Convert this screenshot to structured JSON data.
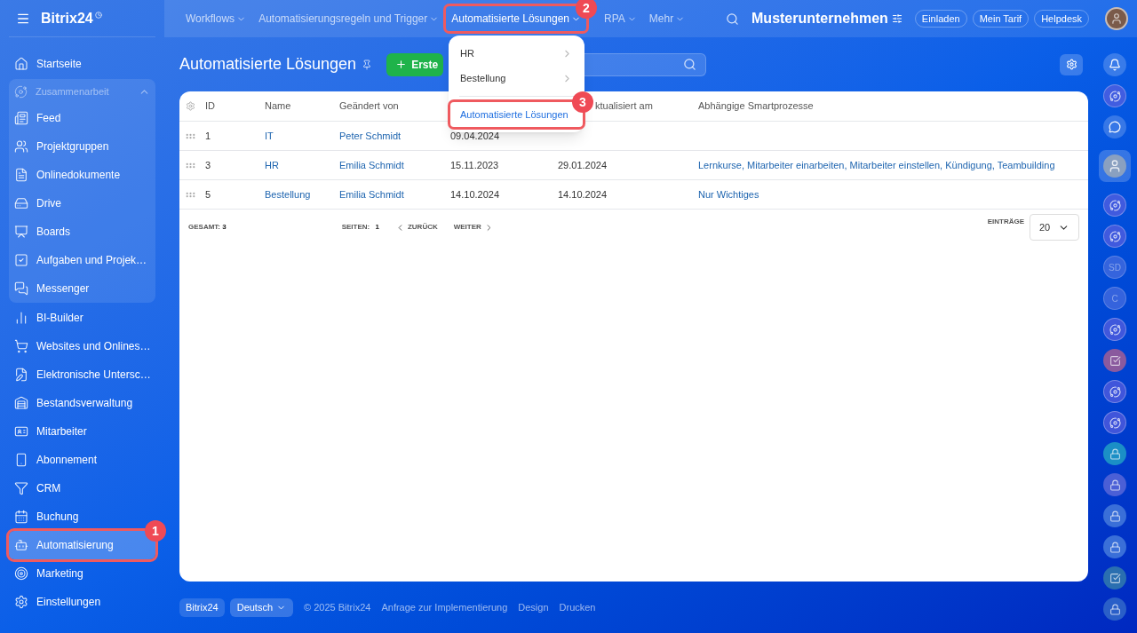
{
  "logo": {
    "text": "Bitrix24"
  },
  "sidebar": {
    "items": [
      {
        "kind": "link",
        "label": "Startseite",
        "selected": false
      },
      {
        "kind": "group",
        "label": "Zusammenarbeit",
        "expanded": true,
        "children": [
          {
            "kind": "link",
            "label": "Feed",
            "selected": false
          },
          {
            "kind": "link",
            "label": "Projektgruppen",
            "selected": false
          },
          {
            "kind": "link",
            "label": "Onlinedokumente",
            "selected": false
          },
          {
            "kind": "link",
            "label": "Drive",
            "selected": false
          },
          {
            "kind": "link",
            "label": "Boards",
            "selected": false
          },
          {
            "kind": "link",
            "label": "Aufgaben und Projek…",
            "selected": false
          },
          {
            "kind": "link",
            "label": "Messenger",
            "selected": false
          }
        ]
      },
      {
        "kind": "link",
        "label": "BI-Builder",
        "selected": false
      },
      {
        "kind": "link",
        "label": "Websites und Onlines…",
        "selected": false
      },
      {
        "kind": "link",
        "label": "Elektronische Untersc…",
        "selected": false
      },
      {
        "kind": "link",
        "label": "Bestandsverwaltung",
        "selected": false
      },
      {
        "kind": "link",
        "label": "Mitarbeiter",
        "selected": false
      },
      {
        "kind": "link",
        "label": "Abonnement",
        "selected": false
      },
      {
        "kind": "link",
        "label": "CRM",
        "selected": false
      },
      {
        "kind": "link",
        "label": "Buchung",
        "selected": false
      },
      {
        "kind": "link",
        "label": "Automatisierung",
        "selected": true,
        "annotation": "1"
      },
      {
        "kind": "link",
        "label": "Marketing",
        "selected": false
      },
      {
        "kind": "link",
        "label": "Einstellungen",
        "selected": false
      }
    ]
  },
  "top_nav": {
    "items": [
      {
        "label": "Workflows",
        "selected": false
      },
      {
        "label": "Automatisierungsregeln und Trigger",
        "selected": false
      },
      {
        "label": "Automatisierte Lösungen",
        "selected": true,
        "annotation": "2"
      },
      {
        "label": "RPA",
        "selected": false
      },
      {
        "label": "Mehr",
        "selected": false
      }
    ],
    "company": "Musterunternehmen",
    "buttons": [
      "Einladen",
      "Mein Tarif",
      "Helpdesk"
    ]
  },
  "dropdown": {
    "items": [
      {
        "kind": "submenu",
        "label": "HR",
        "selected": false
      },
      {
        "kind": "submenu",
        "label": "Bestellung",
        "selected": false
      },
      {
        "kind": "link",
        "label": "Automatisierte Lösungen",
        "selected": true,
        "annotation": "3"
      }
    ]
  },
  "page": {
    "title": "Automatisierte Lösungen",
    "create_button": "Erste"
  },
  "table": {
    "columns": [
      "ID",
      "Name",
      "Geändert von",
      "ktualisiert am",
      "Abhängige Smartprozesse"
    ],
    "rows": [
      {
        "id": "1",
        "name": "IT",
        "changed_by": "Peter Schmidt",
        "created": "09.04.2024"
      },
      {
        "id": "3",
        "name": "HR",
        "changed_by": "Emilia Schmidt",
        "created": "15.11.2023",
        "updated": "29.01.2024",
        "dependent": "Lernkurse, Mitarbeiter einarbeiten, Mitarbeiter einstellen, Kündigung, Teambuilding"
      },
      {
        "id": "5",
        "name": "Bestellung",
        "changed_by": "Emilia Schmidt",
        "created": "14.10.2024",
        "updated": "14.10.2024",
        "dependent": "Nur Wichtiges"
      }
    ],
    "footer": {
      "total_label": "GESAMT:",
      "total": "3",
      "pages_label": "SEITEN:",
      "page": "1",
      "prev": "ZURÜCK",
      "next": "WEITER",
      "per_page_label": "EINTRÄGE",
      "per_page": "20"
    }
  },
  "right_rail": [
    {
      "kind": "bell"
    },
    {
      "kind": "spiral"
    },
    {
      "kind": "chat"
    },
    {
      "kind": "avatar"
    },
    {
      "kind": "spiral"
    },
    {
      "kind": "spiral"
    },
    {
      "kind": "initials",
      "text": "SD"
    },
    {
      "kind": "initials",
      "text": "C"
    },
    {
      "kind": "spiral"
    },
    {
      "kind": "task",
      "color": "#8a5a9e"
    },
    {
      "kind": "spiral"
    },
    {
      "kind": "spiral"
    },
    {
      "kind": "lock",
      "color": "#1b8fc6"
    },
    {
      "kind": "lock",
      "color": "#4b5fd6"
    },
    {
      "kind": "lock",
      "color": "#3a6fd8"
    },
    {
      "kind": "lock",
      "color": "#3a6fd8"
    },
    {
      "kind": "task",
      "color": "#2a6fb0"
    },
    {
      "kind": "lock",
      "color": "#2a5fc8"
    }
  ],
  "footer": {
    "logo": "Bitrix24",
    "language": "Deutsch",
    "copyright": "© 2025 Bitrix24",
    "links": [
      "Anfrage zur Implementierung",
      "Design",
      "Drucken"
    ]
  }
}
